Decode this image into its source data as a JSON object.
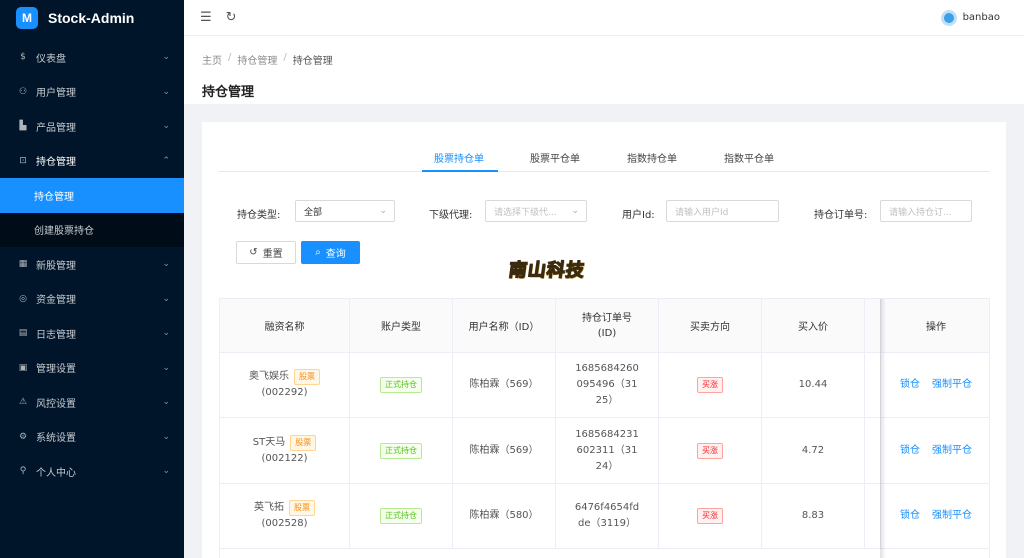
{
  "app": {
    "name": "Stock-Admin",
    "logo_letter": "M"
  },
  "sidebar": {
    "items": [
      {
        "label": "仪表盘",
        "icon": "dollar-icon"
      },
      {
        "label": "用户管理",
        "icon": "users-icon"
      },
      {
        "label": "产品管理",
        "icon": "chart-icon"
      },
      {
        "label": "持仓管理",
        "icon": "download-box-icon",
        "open": true,
        "children": [
          {
            "label": "持仓管理",
            "active": true
          },
          {
            "label": "创建股票持仓"
          }
        ]
      },
      {
        "label": "新股管理",
        "icon": "grid-icon"
      },
      {
        "label": "资金管理",
        "icon": "coin-icon"
      },
      {
        "label": "日志管理",
        "icon": "document-icon"
      },
      {
        "label": "管理设置",
        "icon": "calculator-icon"
      },
      {
        "label": "风控设置",
        "icon": "warning-icon"
      },
      {
        "label": "系统设置",
        "icon": "gear-icon"
      },
      {
        "label": "个人中心",
        "icon": "person-icon"
      }
    ]
  },
  "header": {
    "username": "banbao"
  },
  "breadcrumb": [
    "主页",
    "持仓管理",
    "持仓管理"
  ],
  "page_title": "持仓管理",
  "tabs": [
    "股票持仓单",
    "股票平仓单",
    "指数持仓单",
    "指数平仓单"
  ],
  "filters": {
    "type_label": "持仓类型:",
    "type_value": "全部",
    "agent_label": "下级代理:",
    "agent_placeholder": "请选择下级代...",
    "user_label": "用户Id:",
    "user_placeholder": "请输入用户Id",
    "order_label": "持仓订单号:",
    "order_placeholder": "请输入持仓订..."
  },
  "buttons": {
    "reset": "重置",
    "query": "查询"
  },
  "watermark": "南山科技",
  "table": {
    "columns": [
      "融资名称",
      "账户类型",
      "用户名称（ID）",
      "持仓订单号\n(ID)",
      "买卖方向",
      "买入价",
      "操作"
    ],
    "rows": [
      {
        "name": "奥飞娱乐",
        "tag": "股票",
        "code": "(002292)",
        "account": "正式持仓",
        "user": "陈柏霖（569）",
        "order": "1685684260095496（3125）",
        "direction": "买涨",
        "price": "10.44",
        "actions": [
          "锁仓",
          "强制平仓"
        ]
      },
      {
        "name": "ST天马",
        "tag": "股票",
        "code": "(002122)",
        "account": "正式持仓",
        "user": "陈柏霖（569）",
        "order": "1685684231602311（3124）",
        "direction": "买涨",
        "price": "4.72",
        "actions": [
          "锁仓",
          "强制平仓"
        ]
      },
      {
        "name": "英飞拓",
        "tag": "股票",
        "code": "(002528)",
        "account": "正式持仓",
        "user": "陈柏霖（580）",
        "order": "6476f4654fdde（3119）",
        "direction": "买涨",
        "price": "8.83",
        "actions": [
          "锁仓",
          "强制平仓"
        ]
      }
    ]
  }
}
